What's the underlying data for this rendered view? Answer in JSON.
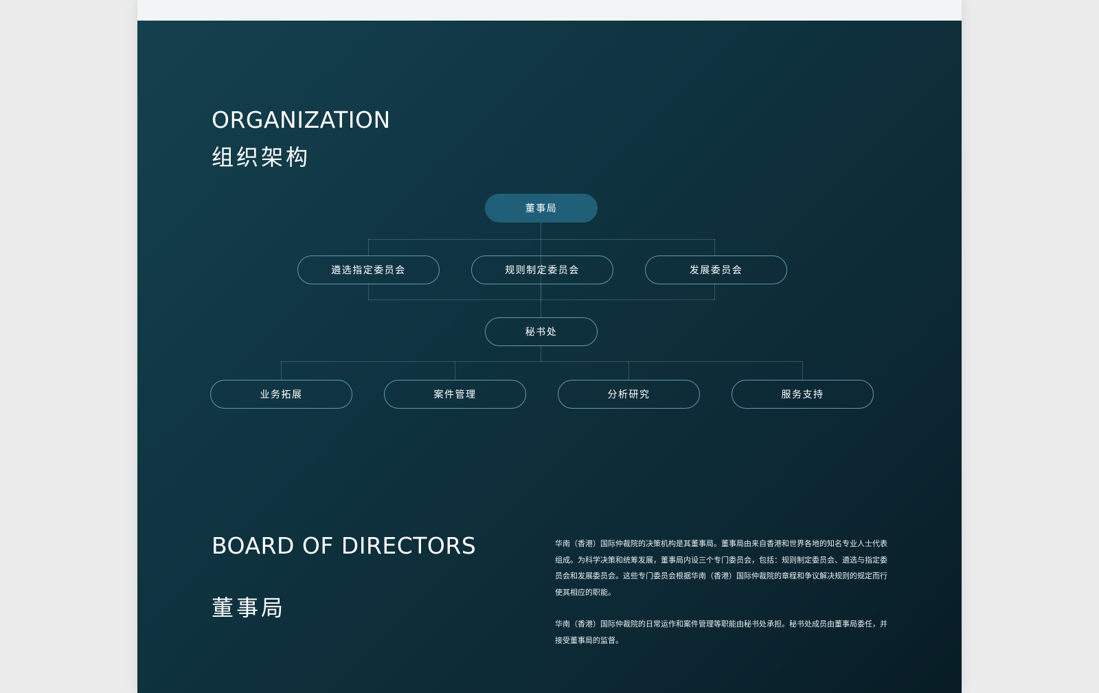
{
  "organization": {
    "title_en": "ORGANIZATION",
    "title_zh": "组织架构",
    "chart": {
      "root": "董事局",
      "committees": [
        "遴选指定委员会",
        "规则制定委员会",
        "发展委员会"
      ],
      "secretariat": "秘书处",
      "departments": [
        "业务拓展",
        "案件管理",
        "分析研究",
        "服务支持"
      ]
    }
  },
  "board": {
    "title_en": "BOARD OF DIRECTORS",
    "title_zh": "董事局",
    "paragraphs": [
      "华南（香港）国际仲裁院的决策机构是其董事局。董事局由来自香港和世界各地的知名专业人士代表组成。为科学决策和统筹发展，董事局内设三个专门委员会，包括：规则制定委员会、遴选与指定委员会和发展委员会。这些专门委员会根据华南（香港）国际仲裁院的章程和争议解决规则的规定而行使其相应的职能。",
      "华南（香港）国际仲裁院的日常运作和案件管理等职能由秘书处承担。秘书处成员由董事局委任，并接受董事局的监督。"
    ]
  },
  "colors": {
    "panel_bg_start": "#14414f",
    "panel_bg_end": "#081c25",
    "root_node_fill": "#1f5f78",
    "node_border": "#5f9aae",
    "topbar": "#f1f5f6"
  }
}
